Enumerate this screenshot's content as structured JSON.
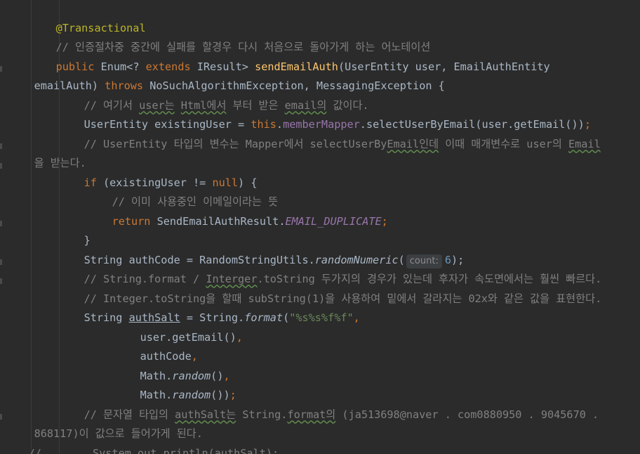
{
  "code": {
    "l1_annotation": "@Transactional",
    "l2_comment": "// 인증절차중 중간에 실패를 할경우 다시 처음으로 돌아가게 하는 어노테이션",
    "l3_public": "public",
    "l3_enum": " Enum<? ",
    "l3_extends": "extends",
    "l3_iresult": " IResult> ",
    "l3_method": "sendEmailAuth",
    "l3_params": "(UserEntity user, EmailAuthEntity",
    "l4_param": "emailAuth) ",
    "l4_throws": "throws",
    "l4_exceptions": " NoSuchAlgorithmException, MessagingException {",
    "l5_comment_a": "// 여기서 ",
    "l5_comment_user": "user는",
    "l5_comment_b": " ",
    "l5_comment_html": "Html에서",
    "l5_comment_c": " 부터 받은 ",
    "l5_comment_email": "email의",
    "l5_comment_d": " 값이다.",
    "l6_type": "UserEntity existingUser = ",
    "l6_this": "this",
    "l6_dot": ".",
    "l6_mapper": "memberMapper",
    "l6_call": ".selectUserByEmail(user.getEmail())",
    "l6_semi": ";",
    "l7_comment_a": "// UserEntity 타입의 변수는 Mapper에서 selectUserBy",
    "l7_comment_email": "Email인데",
    "l7_comment_b": " 이때 매개변수로 user의 ",
    "l7_comment_email2": "Email",
    "l8_comment": "을 받는다.",
    "l9_if": "if",
    "l9_cond": " (existingUser != ",
    "l9_null": "null",
    "l9_close": ") {",
    "l10_comment": "// 이미 사용중인 이메일이라는 뜻",
    "l11_return": "return",
    "l11_cls": " SendEmailAuthResult.",
    "l11_const": "EMAIL_DUPLICATE",
    "l11_semi": ";",
    "l12_brace": "}",
    "l13_decl": "String authCode = RandomStringUtils.",
    "l13_method": "randomNumeric",
    "l13_paren": "(",
    "l13_hint": "count:",
    "l13_num": "6",
    "l13_close": ");",
    "l14_comment_a": "// String.format / ",
    "l14_comment_typo": "Interger",
    "l14_comment_b": ".toString 두가지의 경우가 있는데 후자가 속도면에서는 훨씬 빠르다.",
    "l15_comment": "// Integer.toString을 할때 subString(1)을 사용하여 밑에서 갈라지는 02x와 같은 값을 표현한다.",
    "l16_type": "String ",
    "l16_var": "authSalt",
    "l16_assign": " = String.",
    "l16_format": "format",
    "l16_paren": "(",
    "l16_str": "\"%s%s%f%f\"",
    "l16_comma": ",",
    "l17_expr": "user.getEmail()",
    "l17_comma": ",",
    "l18_expr": "authCode",
    "l18_comma": ",",
    "l19_cls": "Math.",
    "l19_method": "random",
    "l19_paren": "()",
    "l19_comma": ",",
    "l20_cls": "Math.",
    "l20_method": "random",
    "l20_paren": "())",
    "l20_semi": ";",
    "l21_comment_a": "// 문자열 타입의 ",
    "l21_comment_salt": "authSalt는",
    "l21_comment_b": " String.",
    "l21_comment_format": "format의",
    "l21_comment_c": " (ja513698@naver . com0880950 . 9045670 .",
    "l22_comment": "868117)이 값으로 들어가게 된다.",
    "l23_slashes": "//",
    "l23_code": "        System.out.println(authSalt);"
  },
  "colors": {
    "background": "#2b2b2b",
    "default_text": "#a9b7c6",
    "annotation": "#bbb529",
    "comment": "#808080",
    "keyword": "#cc7832",
    "method_decl": "#ffc66d",
    "field": "#9876aa",
    "string": "#6a8759",
    "number": "#6897bb"
  }
}
